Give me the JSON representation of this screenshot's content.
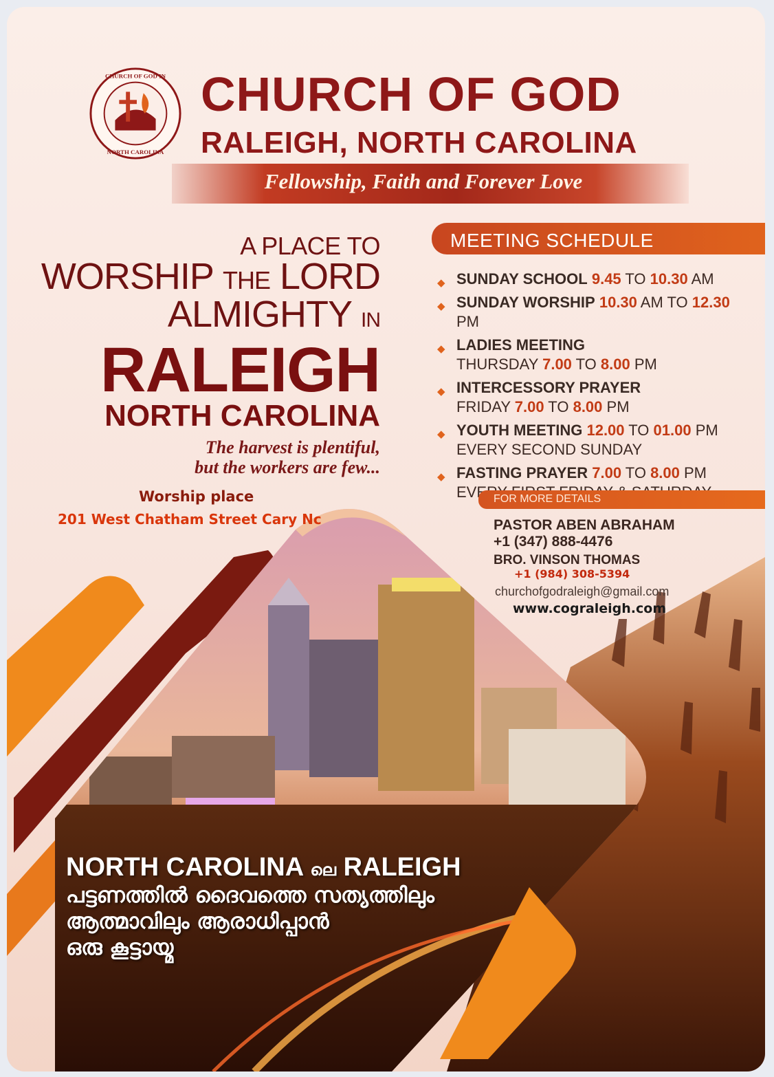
{
  "header": {
    "logo_ring_text": "CHURCH OF GOD IN NORTH CAROLINA RALEIGH",
    "title": "CHURCH OF GOD",
    "subtitle": "RALEIGH, NORTH CAROLINA",
    "tagline": "Fellowship, Faith and Forever Love"
  },
  "headline": {
    "line1": "A PLACE TO",
    "line2_a": "WORSHIP",
    "line2_b": "THE",
    "line2_c": "LORD",
    "line3_a": "ALMIGHTY",
    "line3_b": "IN",
    "line4": "RALEIGH",
    "line5": "NORTH CAROLINA",
    "quote_1": "The harvest is plentiful,",
    "quote_2": "but the workers are few..."
  },
  "worship": {
    "label": "Worship place",
    "address": "201 West Chatham Street Cary Nc"
  },
  "schedule": {
    "title": "MEETING SCHEDULE",
    "items": [
      {
        "name": "SUNDAY SCHOOL",
        "t1": "9.45",
        "sep": " TO ",
        "t2": "10.30",
        "suffix": " AM",
        "line2": ""
      },
      {
        "name": "SUNDAY WORSHIP",
        "t1": "10.30",
        "sep": " AM TO ",
        "t2": "12.30",
        "suffix": " PM",
        "line2": ""
      },
      {
        "name": "LADIES MEETING",
        "line2_pre": "THURSDAY ",
        "t1": "7.00",
        "sep": " TO ",
        "t2": "8.00",
        "suffix": " PM"
      },
      {
        "name": "INTERCESSORY PRAYER",
        "line2_pre": "FRIDAY ",
        "t1": "7.00",
        "sep": " TO ",
        "t2": "8.00",
        "suffix": " PM"
      },
      {
        "name": "YOUTH MEETING",
        "t1": "12.00",
        "sep": " TO ",
        "t2": "01.00",
        "suffix": " PM",
        "line2": "EVERY SECOND SUNDAY"
      },
      {
        "name": "FASTING PRAYER",
        "t1": "7.00",
        "sep": " TO ",
        "t2": "8.00",
        "suffix": " PM",
        "line2": "EVERY FIRST FRIDAY & SATURDAY"
      }
    ]
  },
  "contact": {
    "title": "FOR MORE DETAILS",
    "pastor": "PASTOR ABEN ABRAHAM",
    "pastor_phone": "+1 (347) 888-4476",
    "bro": "BRO. VINSON THOMAS",
    "bro_phone": "+1 (984) 308-5394",
    "email": "churchofgodraleigh@gmail.com",
    "website": "www.cograleigh.com"
  },
  "malayalam": {
    "line1_a": "NORTH CAROLINA",
    "line1_b": "ലെ",
    "line1_c": "RALEIGH",
    "line2": "പട്ടണത്തിൽ ദൈവത്തെ സത്യത്തിലും",
    "line3": "ആത്മാവിലും ആരാധിപ്പാൻ",
    "line4": "ഒരു കൂട്ടായ്മ"
  },
  "colors": {
    "brand_red": "#8e1818",
    "accent_orange": "#e0631d",
    "background": "#fbeee8"
  }
}
